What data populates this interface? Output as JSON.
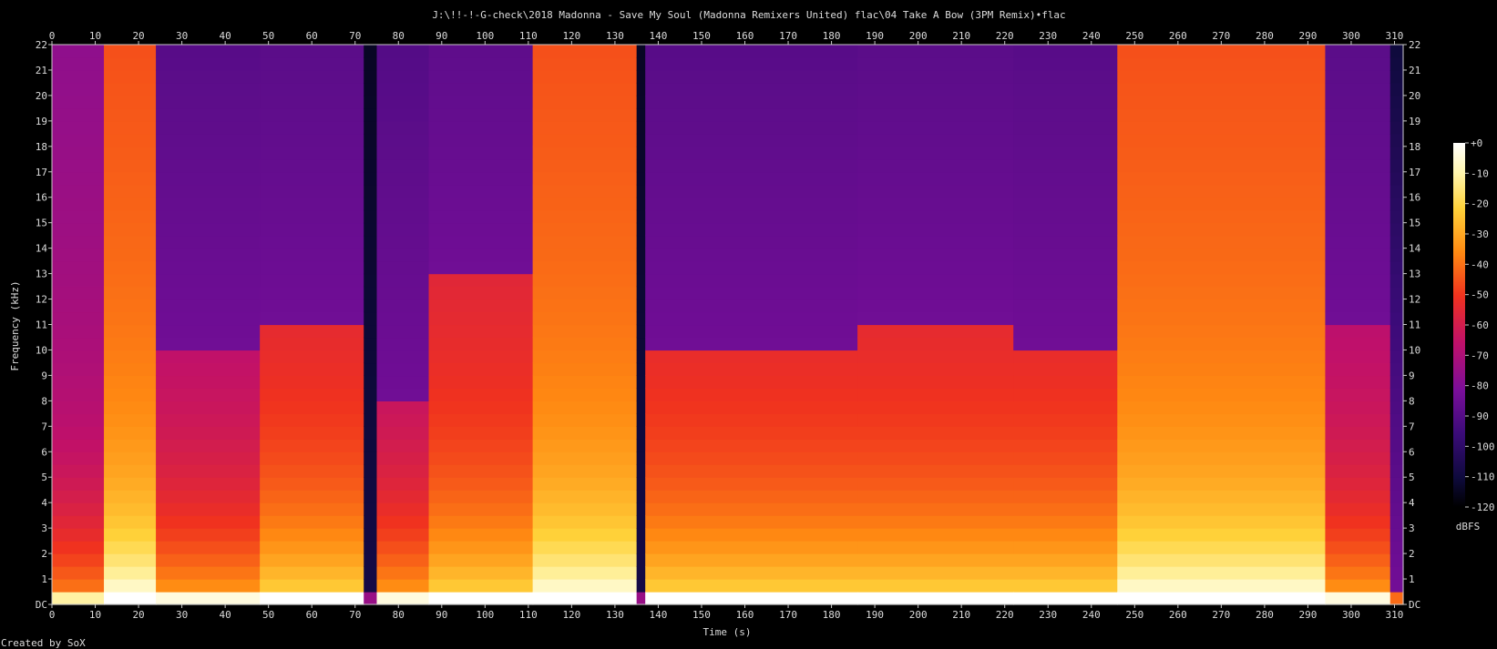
{
  "chart_data": {
    "type": "heatmap",
    "title": "J:\\!!-!-G-check\\2018 Madonna - Save My Soul (Madonna Remixers United) flac\\04 Take A Bow (3PM Remix)•flac",
    "xlabel": "Time (s)",
    "ylabel": "Frequency (kHz)",
    "xlim": [
      0,
      312
    ],
    "ylim": [
      0,
      22
    ],
    "x_ticks": [
      "0",
      "10",
      "20",
      "30",
      "40",
      "50",
      "60",
      "70",
      "80",
      "90",
      "100",
      "110",
      "120",
      "130",
      "140",
      "150",
      "160",
      "170",
      "180",
      "190",
      "200",
      "210",
      "220",
      "230",
      "240",
      "250",
      "260",
      "270",
      "280",
      "290",
      "300",
      "310"
    ],
    "y_ticks": [
      "DC",
      "1",
      "2",
      "3",
      "4",
      "5",
      "6",
      "7",
      "8",
      "9",
      "10",
      "11",
      "12",
      "13",
      "14",
      "15",
      "16",
      "17",
      "18",
      "19",
      "20",
      "21",
      "22"
    ],
    "colorbar": {
      "label": "dBFS",
      "ticks": [
        "+0",
        "-10",
        "-20",
        "-30",
        "-40",
        "-50",
        "-60",
        "-70",
        "-80",
        "-90",
        "-100",
        "-110",
        "-120"
      ],
      "range": [
        -120,
        0
      ]
    },
    "segments": [
      {
        "start": 0,
        "end": 12,
        "level": "low",
        "cutoff_khz": 22,
        "peak": "tonal"
      },
      {
        "start": 12,
        "end": 24,
        "level": "loud",
        "cutoff_khz": 22
      },
      {
        "start": 24,
        "end": 48,
        "level": "quiet",
        "cutoff_khz": 10
      },
      {
        "start": 48,
        "end": 72,
        "level": "medium",
        "cutoff_khz": 11
      },
      {
        "start": 72,
        "end": 75,
        "level": "gap"
      },
      {
        "start": 75,
        "end": 87,
        "level": "quiet",
        "cutoff_khz": 8
      },
      {
        "start": 87,
        "end": 111,
        "level": "medium",
        "cutoff_khz": 13
      },
      {
        "start": 111,
        "end": 135,
        "level": "loud",
        "cutoff_khz": 22
      },
      {
        "start": 135,
        "end": 137,
        "level": "gap"
      },
      {
        "start": 137,
        "end": 186,
        "level": "medium",
        "cutoff_khz": 10
      },
      {
        "start": 186,
        "end": 222,
        "level": "medium",
        "cutoff_khz": 11
      },
      {
        "start": 222,
        "end": 246,
        "level": "medium",
        "cutoff_khz": 10
      },
      {
        "start": 246,
        "end": 294,
        "level": "loud",
        "cutoff_khz": 22
      },
      {
        "start": 294,
        "end": 309,
        "level": "quiet",
        "cutoff_khz": 11
      },
      {
        "start": 309,
        "end": 312,
        "level": "fade"
      }
    ],
    "grid": false
  },
  "footer": "Created by SoX"
}
